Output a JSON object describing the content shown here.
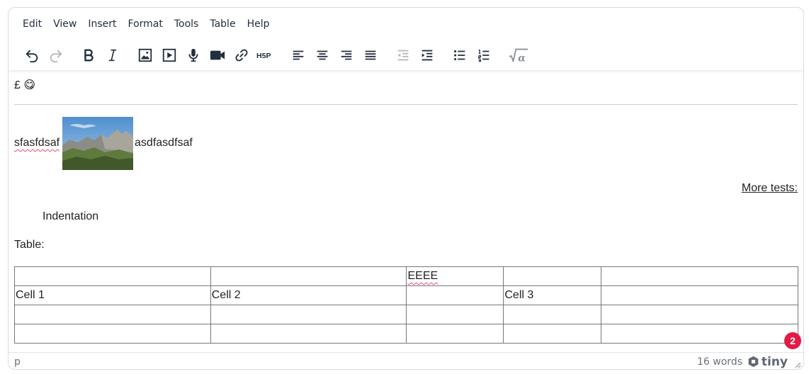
{
  "menubar": {
    "items": [
      "Edit",
      "View",
      "Insert",
      "Format",
      "Tools",
      "Table",
      "Help"
    ]
  },
  "toolbar": {
    "buttons": [
      {
        "name": "undo-icon"
      },
      {
        "name": "redo-icon"
      },
      {
        "name": "bold-icon"
      },
      {
        "name": "italic-icon"
      },
      {
        "name": "image-icon"
      },
      {
        "name": "media-icon"
      },
      {
        "name": "microphone-icon"
      },
      {
        "name": "video-camera-icon"
      },
      {
        "name": "link-icon"
      },
      {
        "name": "h5p-icon"
      },
      {
        "name": "align-left-icon"
      },
      {
        "name": "align-center-icon"
      },
      {
        "name": "align-right-icon"
      },
      {
        "name": "align-justify-icon"
      },
      {
        "name": "outdent-icon"
      },
      {
        "name": "indent-icon"
      },
      {
        "name": "bullet-list-icon"
      },
      {
        "name": "numbered-list-icon"
      },
      {
        "name": "equation-icon"
      }
    ],
    "h5p_label": "H5P"
  },
  "content": {
    "line1_text": "£",
    "emoji": "😋",
    "text_before_image": "sfasfdsaf",
    "text_after_image": "asdfasdfsaf",
    "more_tests_link": "More tests:",
    "indented_text": "Indentation",
    "table_label": "Table:",
    "table": {
      "rows": [
        [
          "",
          "",
          "EEEE",
          "",
          ""
        ],
        [
          "Cell 1",
          "Cell 2",
          "",
          "Cell 3",
          ""
        ],
        [
          "",
          "",
          "",
          "",
          ""
        ],
        [
          "",
          "",
          "",
          "",
          ""
        ]
      ]
    }
  },
  "statusbar": {
    "path": "p",
    "word_count": "16 words",
    "brand": "tiny"
  },
  "notification_badge": "2",
  "colors": {
    "accent": "#e31b45",
    "spell_underline": "#e74c6e",
    "text": "#222f3e"
  }
}
